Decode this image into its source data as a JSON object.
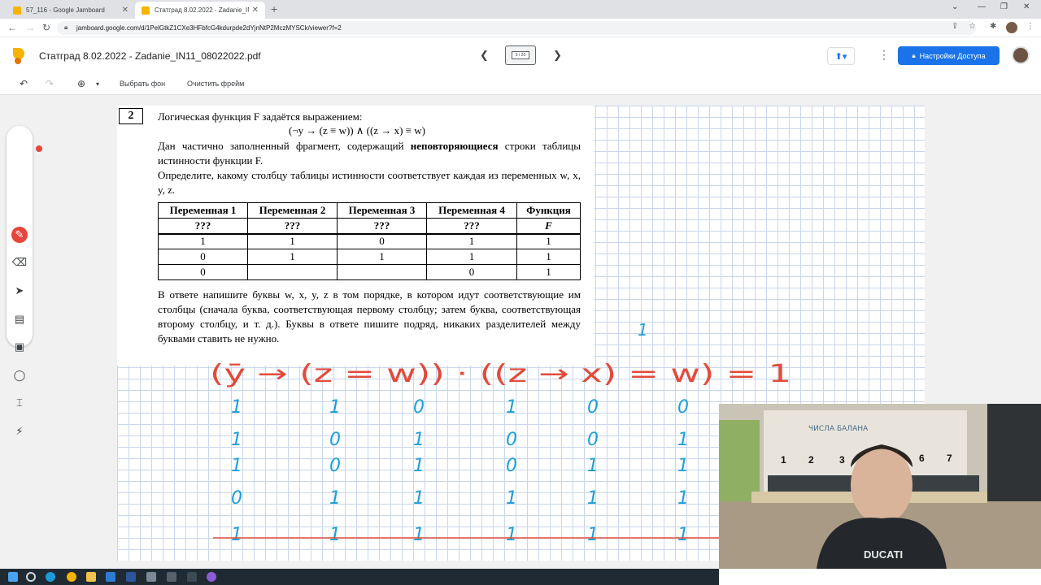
{
  "browser": {
    "tabs": [
      {
        "title": "57_116 - Google Jamboard"
      },
      {
        "title": "Статград 8.02.2022 - Zadanie_IN11"
      }
    ],
    "url": "jamboard.google.com/d/1PelGtkZ1CXe3HFbfcG4kdurpde2dYjnNtP2MczMYSCk/viewer?f=2"
  },
  "jamboard": {
    "title": "Статград 8.02.2022 - Zadanie_IN11_08022022.pdf",
    "frame_indicator": "3 / 20",
    "access_button": "Настройки Доступа",
    "toolbar": {
      "set_background": "Выбрать фон",
      "clear_frame": "Очистить фрейм"
    }
  },
  "task": {
    "number": "2",
    "intro": "Логическая функция F задаётся выражением:",
    "formula": "(¬y → (z ≡ w)) ∧ ((z → x) ≡ w)",
    "para1_a": "Дан частично заполненный фрагмент, содержащий",
    "para1_bold": "неповторяющиеся",
    "para1_b": "строки таблицы истинности функции F.",
    "para2": "Определите, какому столбцу таблицы истинности соответствует каждая из переменных w, x, y, z.",
    "table": {
      "headers": [
        "Переменная 1",
        "Переменная 2",
        "Переменная 3",
        "Переменная 4",
        "Функция"
      ],
      "subheaders": [
        "???",
        "???",
        "???",
        "???",
        "F"
      ],
      "rows": [
        [
          "1",
          "1",
          "0",
          "1",
          "1"
        ],
        [
          "0",
          "1",
          "1",
          "1",
          "1"
        ],
        [
          "0",
          "",
          "",
          "0",
          "1"
        ]
      ]
    },
    "para3": "В ответе напишите буквы w, x, y, z в том порядке, в котором идут соответствующие им столбцы (сначала буква, соответствующая первому столбцу; затем буква, соответствующая второму столбцу, и т. д.). Буквы в ответе пишите подряд, никаких разделителей между буквами ставить не нужно."
  },
  "handwriting": {
    "expression": "(ȳ → (z = w)) · ((z → x) = w) = 1",
    "note_top": "1",
    "columns": [
      [
        "1",
        "1",
        "1",
        "0",
        "1"
      ],
      [
        "1",
        "0",
        "0",
        "1",
        "1"
      ],
      [
        "0",
        "1",
        "1",
        "1",
        "1"
      ],
      [
        "1",
        "0",
        "0",
        "1",
        "1"
      ],
      [
        "0",
        "0",
        "1",
        "1",
        "1"
      ],
      [
        "0",
        "1",
        "1",
        "1",
        "1"
      ]
    ],
    "ink_colors": {
      "red": "#e24b3b",
      "blue": "#1d9fd8"
    }
  },
  "webcam": {
    "poster_text": "ЧИСЛА БАЛАНА",
    "number_labels": [
      "1",
      "2",
      "3",
      "6",
      "7"
    ],
    "shirt_text": "DUCATI"
  },
  "icons": {
    "side_tools": [
      "pen-icon",
      "eraser-icon",
      "select-icon",
      "sticky-note-icon",
      "image-icon",
      "circle-icon",
      "text-box-icon",
      "laser-icon"
    ]
  }
}
